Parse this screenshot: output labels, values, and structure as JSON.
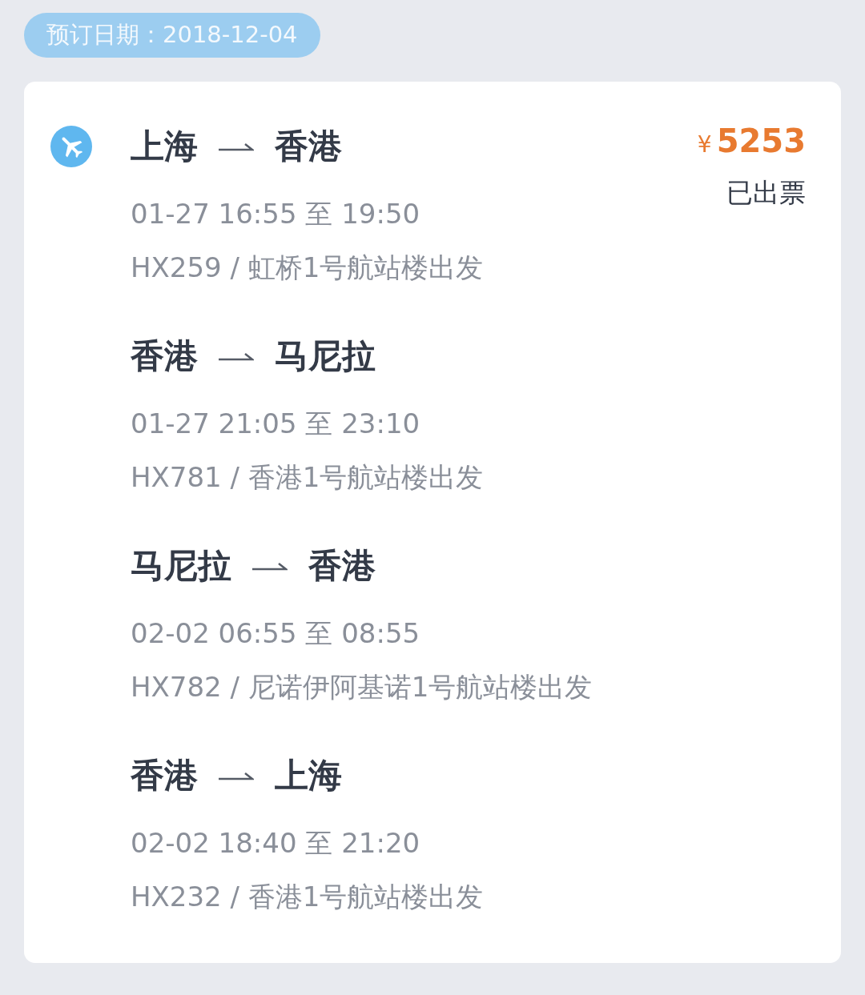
{
  "booking_date": "预订日期：2018-12-04",
  "order": {
    "currency": "¥",
    "price": "5253",
    "status": "已出票",
    "segments": [
      {
        "from": "上海",
        "to": "香港",
        "time": "01-27 16:55 至 19:50",
        "flight": "HX259 / 虹桥1号航站楼出发"
      },
      {
        "from": "香港",
        "to": "马尼拉",
        "time": "01-27 21:05 至 23:10",
        "flight": "HX781 / 香港1号航站楼出发"
      },
      {
        "from": "马尼拉",
        "to": "香港",
        "time": "02-02 06:55 至 08:55",
        "flight": "HX782 / 尼诺伊阿基诺1号航站楼出发"
      },
      {
        "from": "香港",
        "to": "上海",
        "time": "02-02 18:40 至 21:20",
        "flight": "HX232 / 香港1号航站楼出发"
      }
    ]
  }
}
